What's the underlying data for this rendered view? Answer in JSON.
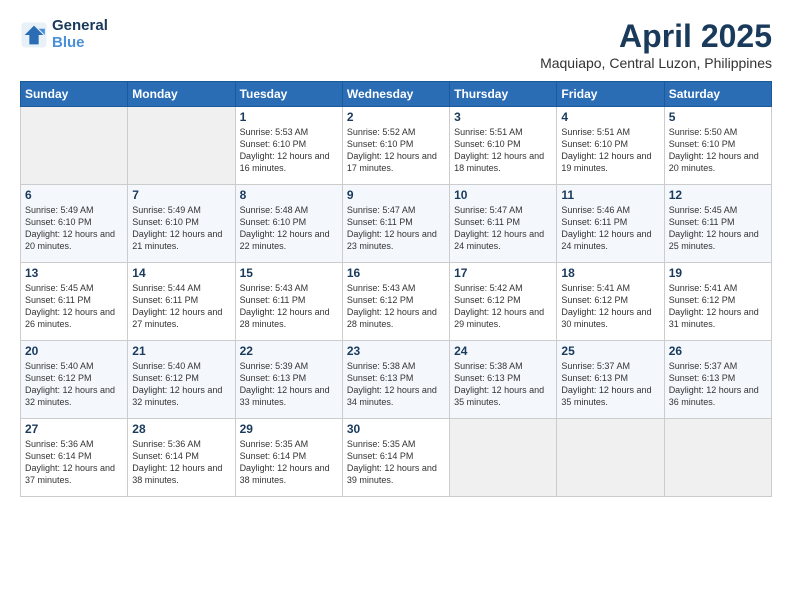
{
  "logo": {
    "line1": "General",
    "line2": "Blue"
  },
  "title": "April 2025",
  "subtitle": "Maquiapo, Central Luzon, Philippines",
  "headers": [
    "Sunday",
    "Monday",
    "Tuesday",
    "Wednesday",
    "Thursday",
    "Friday",
    "Saturday"
  ],
  "weeks": [
    [
      {
        "day": "",
        "info": ""
      },
      {
        "day": "",
        "info": ""
      },
      {
        "day": "1",
        "info": "Sunrise: 5:53 AM\nSunset: 6:10 PM\nDaylight: 12 hours and 16 minutes."
      },
      {
        "day": "2",
        "info": "Sunrise: 5:52 AM\nSunset: 6:10 PM\nDaylight: 12 hours and 17 minutes."
      },
      {
        "day": "3",
        "info": "Sunrise: 5:51 AM\nSunset: 6:10 PM\nDaylight: 12 hours and 18 minutes."
      },
      {
        "day": "4",
        "info": "Sunrise: 5:51 AM\nSunset: 6:10 PM\nDaylight: 12 hours and 19 minutes."
      },
      {
        "day": "5",
        "info": "Sunrise: 5:50 AM\nSunset: 6:10 PM\nDaylight: 12 hours and 20 minutes."
      }
    ],
    [
      {
        "day": "6",
        "info": "Sunrise: 5:49 AM\nSunset: 6:10 PM\nDaylight: 12 hours and 20 minutes."
      },
      {
        "day": "7",
        "info": "Sunrise: 5:49 AM\nSunset: 6:10 PM\nDaylight: 12 hours and 21 minutes."
      },
      {
        "day": "8",
        "info": "Sunrise: 5:48 AM\nSunset: 6:10 PM\nDaylight: 12 hours and 22 minutes."
      },
      {
        "day": "9",
        "info": "Sunrise: 5:47 AM\nSunset: 6:11 PM\nDaylight: 12 hours and 23 minutes."
      },
      {
        "day": "10",
        "info": "Sunrise: 5:47 AM\nSunset: 6:11 PM\nDaylight: 12 hours and 24 minutes."
      },
      {
        "day": "11",
        "info": "Sunrise: 5:46 AM\nSunset: 6:11 PM\nDaylight: 12 hours and 24 minutes."
      },
      {
        "day": "12",
        "info": "Sunrise: 5:45 AM\nSunset: 6:11 PM\nDaylight: 12 hours and 25 minutes."
      }
    ],
    [
      {
        "day": "13",
        "info": "Sunrise: 5:45 AM\nSunset: 6:11 PM\nDaylight: 12 hours and 26 minutes."
      },
      {
        "day": "14",
        "info": "Sunrise: 5:44 AM\nSunset: 6:11 PM\nDaylight: 12 hours and 27 minutes."
      },
      {
        "day": "15",
        "info": "Sunrise: 5:43 AM\nSunset: 6:11 PM\nDaylight: 12 hours and 28 minutes."
      },
      {
        "day": "16",
        "info": "Sunrise: 5:43 AM\nSunset: 6:12 PM\nDaylight: 12 hours and 28 minutes."
      },
      {
        "day": "17",
        "info": "Sunrise: 5:42 AM\nSunset: 6:12 PM\nDaylight: 12 hours and 29 minutes."
      },
      {
        "day": "18",
        "info": "Sunrise: 5:41 AM\nSunset: 6:12 PM\nDaylight: 12 hours and 30 minutes."
      },
      {
        "day": "19",
        "info": "Sunrise: 5:41 AM\nSunset: 6:12 PM\nDaylight: 12 hours and 31 minutes."
      }
    ],
    [
      {
        "day": "20",
        "info": "Sunrise: 5:40 AM\nSunset: 6:12 PM\nDaylight: 12 hours and 32 minutes."
      },
      {
        "day": "21",
        "info": "Sunrise: 5:40 AM\nSunset: 6:12 PM\nDaylight: 12 hours and 32 minutes."
      },
      {
        "day": "22",
        "info": "Sunrise: 5:39 AM\nSunset: 6:13 PM\nDaylight: 12 hours and 33 minutes."
      },
      {
        "day": "23",
        "info": "Sunrise: 5:38 AM\nSunset: 6:13 PM\nDaylight: 12 hours and 34 minutes."
      },
      {
        "day": "24",
        "info": "Sunrise: 5:38 AM\nSunset: 6:13 PM\nDaylight: 12 hours and 35 minutes."
      },
      {
        "day": "25",
        "info": "Sunrise: 5:37 AM\nSunset: 6:13 PM\nDaylight: 12 hours and 35 minutes."
      },
      {
        "day": "26",
        "info": "Sunrise: 5:37 AM\nSunset: 6:13 PM\nDaylight: 12 hours and 36 minutes."
      }
    ],
    [
      {
        "day": "27",
        "info": "Sunrise: 5:36 AM\nSunset: 6:14 PM\nDaylight: 12 hours and 37 minutes."
      },
      {
        "day": "28",
        "info": "Sunrise: 5:36 AM\nSunset: 6:14 PM\nDaylight: 12 hours and 38 minutes."
      },
      {
        "day": "29",
        "info": "Sunrise: 5:35 AM\nSunset: 6:14 PM\nDaylight: 12 hours and 38 minutes."
      },
      {
        "day": "30",
        "info": "Sunrise: 5:35 AM\nSunset: 6:14 PM\nDaylight: 12 hours and 39 minutes."
      },
      {
        "day": "",
        "info": ""
      },
      {
        "day": "",
        "info": ""
      },
      {
        "day": "",
        "info": ""
      }
    ]
  ]
}
